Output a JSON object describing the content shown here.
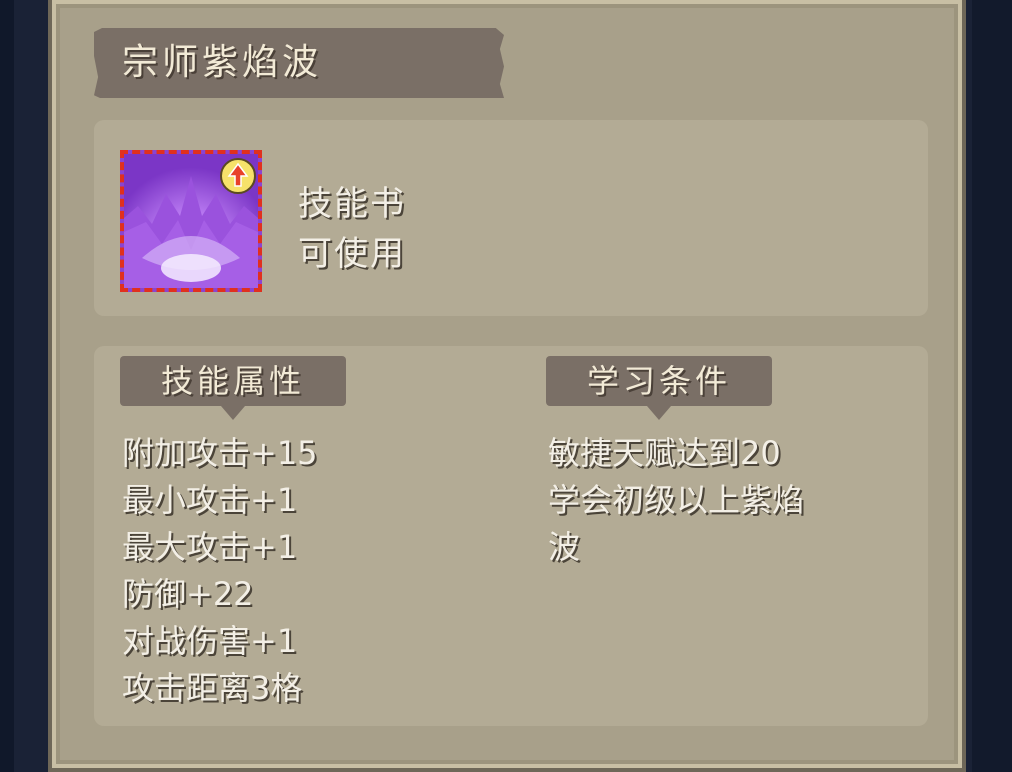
{
  "title": "宗师紫焰波",
  "item": {
    "type_label": "技能书",
    "usable_label": "可使用",
    "icon": "purple-flame-wave-icon",
    "badge_icon": "upgrade-arrow-icon"
  },
  "attributes": {
    "header": "技能属性",
    "lines": [
      "附加攻击+15",
      "最小攻击+1",
      "最大攻击+1",
      "防御+22",
      "对战伤害+1",
      "攻击距离3格"
    ]
  },
  "requirements": {
    "header": "学习条件",
    "lines": [
      "敏捷天赋达到20",
      "学会初级以上紫焰",
      "波"
    ]
  },
  "colors": {
    "panel_bg": "#a8a08a",
    "card_bg": "#b3ab95",
    "banner_bg": "#7a6f66",
    "text": "#f3efe6",
    "frame": "#1a2236",
    "icon_border": "#e0301e",
    "icon_fill": "#8a44d2"
  }
}
